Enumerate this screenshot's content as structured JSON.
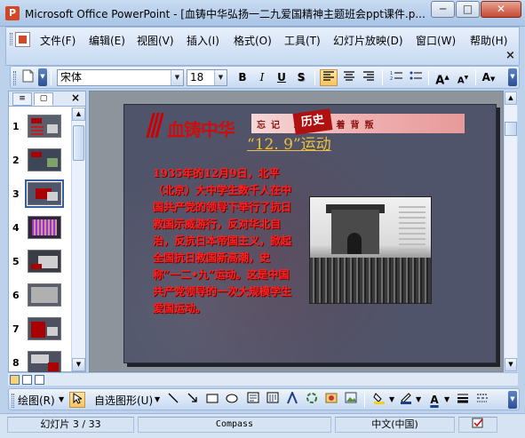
{
  "window": {
    "title": "Microsoft Office PowerPoint - [血铸中华弘扬一二九爱国精神主题班会ppt课件.p...",
    "minimize": "─",
    "maximize": "□",
    "close": "✕"
  },
  "menu": {
    "items": [
      "文件(F)",
      "编辑(E)",
      "视图(V)",
      "插入(I)",
      "格式(O)",
      "工具(T)",
      "幻灯片放映(D)",
      "窗口(W)",
      "帮助(H)"
    ],
    "close": "×"
  },
  "format_toolbar": {
    "font": "宋体",
    "size": "18",
    "bold": "B",
    "italic": "I",
    "underline": "U",
    "shadow": "S",
    "font_color_label": "A"
  },
  "outline_pane": {
    "close": "×",
    "slides": [
      {
        "num": "1",
        "style": "dark"
      },
      {
        "num": "2",
        "style": "dark"
      },
      {
        "num": "3",
        "style": "red",
        "selected": true
      },
      {
        "num": "4",
        "style": "purple"
      },
      {
        "num": "5",
        "style": "dark"
      },
      {
        "num": "6",
        "style": "dark"
      },
      {
        "num": "7",
        "style": "red"
      },
      {
        "num": "8",
        "style": "dark"
      }
    ]
  },
  "slide": {
    "logo_text": "血铸中华",
    "banner_text": "忘记 就意味着背叛",
    "banner_stamp": "历史",
    "title": "“12. 9”运动",
    "body": "1935年的12月9日，北平（北京）大中学生数千人在中国共产党的领导下举行了抗日救国示威游行，反对华北自治，反抗日本帝国主义，掀起全国抗日救国新高潮，史称“一二•九”运动。这是中国共产党领导的一次大规模学生爱国运动。"
  },
  "draw_toolbar": {
    "draw": "绘图(R)",
    "autoshapes": "自选图形(U)"
  },
  "status": {
    "slide_info": "幻灯片 3 / 33",
    "design": "Compass",
    "language": "中文(中国)"
  },
  "colors": {
    "accent": "#d24726",
    "slide_bg": "#50546a",
    "body_text": "#ff2020",
    "title_text": "#eac13d"
  }
}
